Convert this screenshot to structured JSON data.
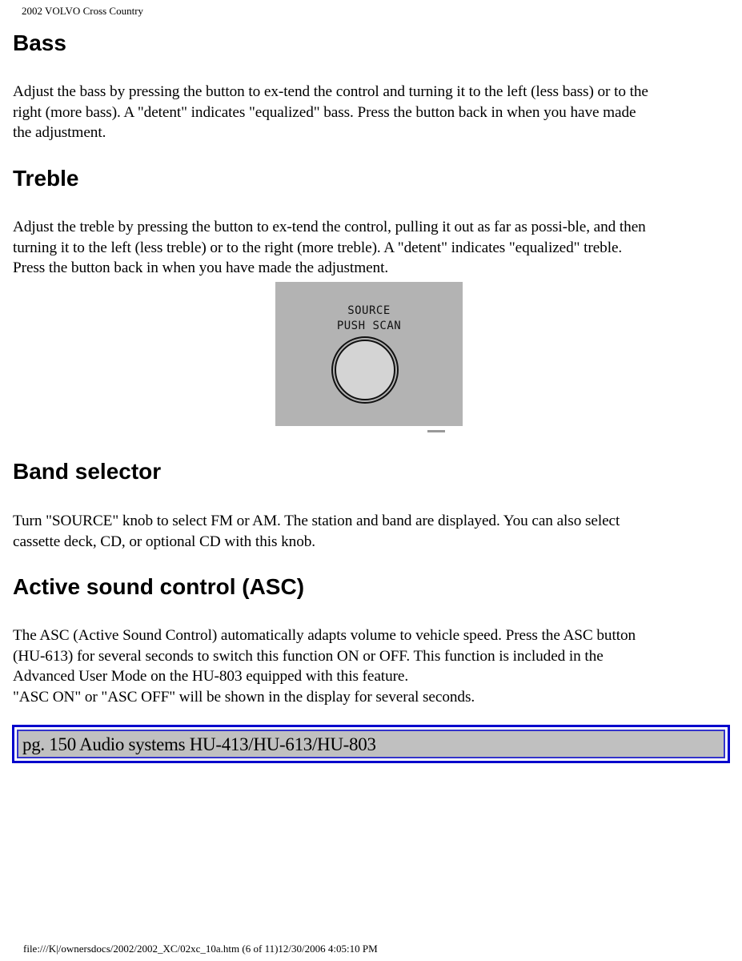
{
  "header": {
    "title": "2002 VOLVO Cross Country"
  },
  "sections": [
    {
      "heading": "Bass",
      "lines": [
        "Adjust the bass by pressing the button to ex-tend the control and turning it to the left (less bass) or to the",
        "right (more bass). A \"detent\" indicates \"equalized\" bass. Press the button back in when you have made",
        "the adjustment."
      ]
    },
    {
      "heading": "Treble",
      "lines": [
        "Adjust the treble by pressing the button to ex-tend the control, pulling it out as far as possi-ble, and then",
        "turning it to the left (less treble) or to the right (more treble). A \"detent\" indicates \"equalized\" treble.",
        "Press the button back in when you have made the adjustment."
      ]
    },
    {
      "heading": "Band selector",
      "lines": [
        "Turn \"SOURCE\" knob to select FM or AM. The station and band are displayed. You can also select",
        "cassette deck, CD, or optional CD with this knob."
      ]
    },
    {
      "heading": "Active sound control (ASC)",
      "lines": [
        "The ASC (Active Sound Control) automatically adapts volume to vehicle speed. Press the ASC button",
        "(HU-613) for several seconds to switch this function ON or OFF. This function is included in the",
        "Advanced User Mode on the HU-803 equipped with this feature.",
        "\"ASC ON\" or \"ASC OFF\" will be shown in the display for several seconds."
      ]
    }
  ],
  "figure": {
    "label_line1": "SOURCE",
    "label_line2": "PUSH SCAN",
    "icon": "source-knob-icon"
  },
  "nav_box": {
    "text": "pg. 150 Audio systems HU-413/HU-613/HU-803"
  },
  "footer": {
    "text": "file:///K|/ownersdocs/2002/2002_XC/02xc_10a.htm (6 of 11)12/30/2006 4:05:10 PM"
  }
}
